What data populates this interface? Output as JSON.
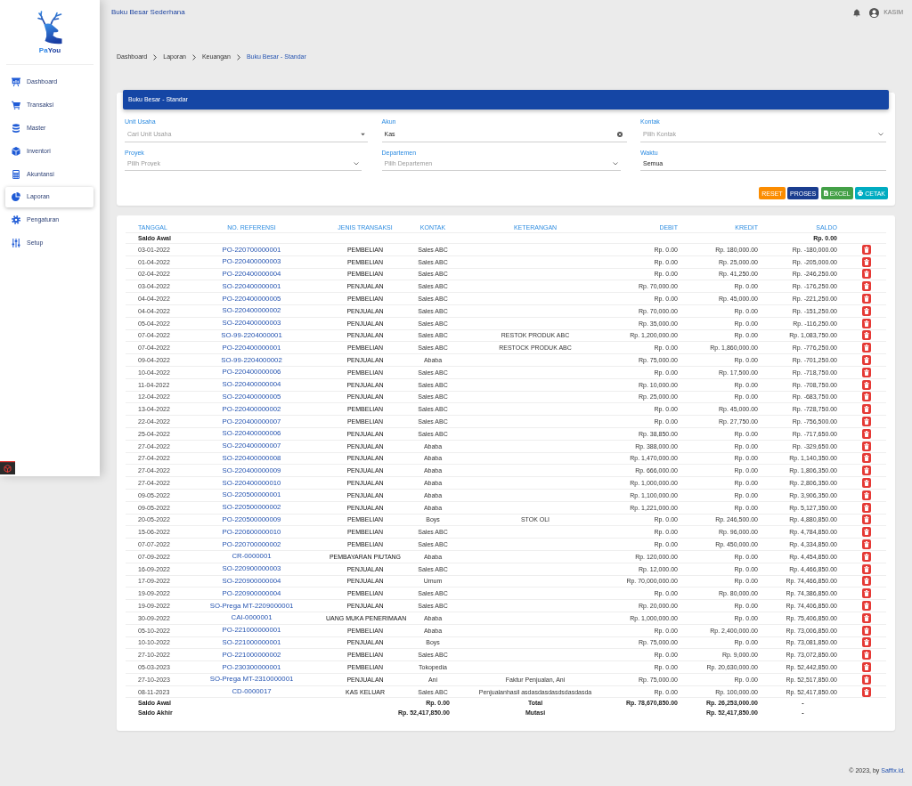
{
  "sidebar": {
    "brand": [
      "Pa",
      "You"
    ],
    "items": [
      {
        "label": "Dashboard",
        "selected": false
      },
      {
        "label": "Transaksi",
        "selected": false
      },
      {
        "label": "Master",
        "selected": false
      },
      {
        "label": "Inventori",
        "selected": false
      },
      {
        "label": "Akuntansi",
        "selected": false
      },
      {
        "label": "Laporan",
        "selected": true
      },
      {
        "label": "Pengaturan",
        "selected": false
      },
      {
        "label": "Setup",
        "selected": false
      }
    ]
  },
  "header": {
    "title": "Buku Besar Sederhana",
    "user": "KASIM"
  },
  "breadcrumb": [
    {
      "label": "Dashboard",
      "current": false
    },
    {
      "label": "Laporan",
      "current": false
    },
    {
      "label": "Keuangan",
      "current": false
    },
    {
      "label": "Buku Besar - Standar",
      "current": true
    }
  ],
  "filters": {
    "title": "Buku Besar - Standar",
    "fields": [
      {
        "label": "Unit Usaha",
        "kind": "combo",
        "placeholder": "Cari Unit Usaha"
      },
      {
        "label": "Akun",
        "kind": "clearable",
        "value": "Kas"
      },
      {
        "label": "Kontak",
        "kind": "select",
        "placeholder": "Pilih Kontak"
      },
      {
        "label": "Proyek",
        "kind": "select",
        "placeholder": "Pilih Proyek"
      },
      {
        "label": "Departemen",
        "kind": "select",
        "placeholder": "Pilih Departemen"
      },
      {
        "label": "Waktu",
        "kind": "text",
        "value": "Semua"
      }
    ],
    "buttons": [
      {
        "label": "RESET",
        "kind": "reset"
      },
      {
        "label": "PROSES",
        "kind": "process"
      },
      {
        "label": "EXCEL",
        "kind": "export"
      },
      {
        "label": "CETAK",
        "kind": "print"
      }
    ]
  },
  "ledger": {
    "columns": [
      "TANGGAL",
      "NO. REFERENSI",
      "JENIS TRANSAKSI",
      "KONTAK",
      "KETERANGAN",
      "DEBIT",
      "KREDIT",
      "SALDO"
    ],
    "opening": {
      "label": "Saldo Awal",
      "balance": "Rp. 0.00"
    },
    "rows": [
      {
        "date": "03-01-2022",
        "ref": "PO-220700000001",
        "type": "PEMBELIAN",
        "contact": "Sales ABC",
        "debit": "Rp. 0.00",
        "credit": "Rp. 180,000.00",
        "balance": "Rp. -180,000.00"
      },
      {
        "date": "01-04-2022",
        "ref": "PO-220400000003",
        "type": "PEMBELIAN",
        "contact": "Sales ABC",
        "debit": "Rp. 0.00",
        "credit": "Rp. 25,000.00",
        "balance": "Rp. -205,000.00"
      },
      {
        "date": "02-04-2022",
        "ref": "PO-220400000004",
        "type": "PEMBELIAN",
        "contact": "Sales ABC",
        "debit": "Rp. 0.00",
        "credit": "Rp. 41,250.00",
        "balance": "Rp. -246,250.00"
      },
      {
        "date": "03-04-2022",
        "ref": "SO-220400000001",
        "type": "PENJUALAN",
        "contact": "Sales ABC",
        "debit": "Rp. 70,000.00",
        "credit": "Rp. 0.00",
        "balance": "Rp. -176,250.00"
      },
      {
        "date": "04-04-2022",
        "ref": "PO-220400000005",
        "type": "PEMBELIAN",
        "contact": "Sales ABC",
        "debit": "Rp. 0.00",
        "credit": "Rp. 45,000.00",
        "balance": "Rp. -221,250.00"
      },
      {
        "date": "04-04-2022",
        "ref": "SO-220400000002",
        "type": "PENJUALAN",
        "contact": "Sales ABC",
        "debit": "Rp. 70,000.00",
        "credit": "Rp. 0.00",
        "balance": "Rp. -151,250.00"
      },
      {
        "date": "05-04-2022",
        "ref": "SO-220400000003",
        "type": "PENJUALAN",
        "contact": "Sales ABC",
        "debit": "Rp. 35,000.00",
        "credit": "Rp. 0.00",
        "balance": "Rp. -116,250.00"
      },
      {
        "date": "07-04-2022",
        "ref": "SO-99-2204000001",
        "type": "PENJUALAN",
        "contact": "Sales ABC",
        "note": "RESTOK PRODUK ABC",
        "debit": "Rp. 1,200,000.00",
        "credit": "Rp. 0.00",
        "balance": "Rp. 1,083,750.00"
      },
      {
        "date": "07-04-2022",
        "ref": "PO-220400000001",
        "type": "PEMBELIAN",
        "contact": "Sales ABC",
        "note": "RESTOCK PRODUK ABC",
        "debit": "Rp. 0.00",
        "credit": "Rp. 1,860,000.00",
        "balance": "Rp. -776,250.00"
      },
      {
        "date": "09-04-2022",
        "ref": "SO-99-2204000002",
        "type": "PENJUALAN",
        "contact": "Ababa",
        "debit": "Rp. 75,000.00",
        "credit": "Rp. 0.00",
        "balance": "Rp. -701,250.00"
      },
      {
        "date": "10-04-2022",
        "ref": "PO-220400000006",
        "type": "PEMBELIAN",
        "contact": "Sales ABC",
        "debit": "Rp. 0.00",
        "credit": "Rp. 17,500.00",
        "balance": "Rp. -718,750.00"
      },
      {
        "date": "11-04-2022",
        "ref": "SO-220400000004",
        "type": "PENJUALAN",
        "contact": "Sales ABC",
        "debit": "Rp. 10,000.00",
        "credit": "Rp. 0.00",
        "balance": "Rp. -708,750.00"
      },
      {
        "date": "12-04-2022",
        "ref": "SO-220400000005",
        "type": "PENJUALAN",
        "contact": "Sales ABC",
        "debit": "Rp. 25,000.00",
        "credit": "Rp. 0.00",
        "balance": "Rp. -683,750.00"
      },
      {
        "date": "13-04-2022",
        "ref": "PO-220400000002",
        "type": "PEMBELIAN",
        "contact": "Sales ABC",
        "debit": "Rp. 0.00",
        "credit": "Rp. 45,000.00",
        "balance": "Rp. -728,750.00"
      },
      {
        "date": "22-04-2022",
        "ref": "PO-220400000007",
        "type": "PEMBELIAN",
        "contact": "Sales ABC",
        "debit": "Rp. 0.00",
        "credit": "Rp. 27,750.00",
        "balance": "Rp. -756,500.00"
      },
      {
        "date": "25-04-2022",
        "ref": "SO-220400000006",
        "type": "PENJUALAN",
        "contact": "Sales ABC",
        "debit": "Rp. 38,850.00",
        "credit": "Rp. 0.00",
        "balance": "Rp. -717,650.00"
      },
      {
        "date": "27-04-2022",
        "ref": "SO-220400000007",
        "type": "PENJUALAN",
        "contact": "Ababa",
        "debit": "Rp. 388,000.00",
        "credit": "Rp. 0.00",
        "balance": "Rp. -329,650.00"
      },
      {
        "date": "27-04-2022",
        "ref": "SO-220400000008",
        "type": "PENJUALAN",
        "contact": "Ababa",
        "debit": "Rp. 1,470,000.00",
        "credit": "Rp. 0.00",
        "balance": "Rp. 1,140,350.00"
      },
      {
        "date": "27-04-2022",
        "ref": "SO-220400000009",
        "type": "PENJUALAN",
        "contact": "Ababa",
        "debit": "Rp. 666,000.00",
        "credit": "Rp. 0.00",
        "balance": "Rp. 1,806,350.00"
      },
      {
        "date": "27-04-2022",
        "ref": "SO-220400000010",
        "type": "PENJUALAN",
        "contact": "Ababa",
        "debit": "Rp. 1,000,000.00",
        "credit": "Rp. 0.00",
        "balance": "Rp. 2,806,350.00"
      },
      {
        "date": "09-05-2022",
        "ref": "SO-220500000001",
        "type": "PENJUALAN",
        "contact": "Ababa",
        "debit": "Rp. 1,100,000.00",
        "credit": "Rp. 0.00",
        "balance": "Rp. 3,906,350.00"
      },
      {
        "date": "09-05-2022",
        "ref": "SO-220500000002",
        "type": "PENJUALAN",
        "contact": "Ababa",
        "debit": "Rp. 1,221,000.00",
        "credit": "Rp. 0.00",
        "balance": "Rp. 5,127,350.00"
      },
      {
        "date": "20-05-2022",
        "ref": "PO-220500000009",
        "type": "PEMBELIAN",
        "contact": "Boys",
        "note": "STOK OLI",
        "debit": "Rp. 0.00",
        "credit": "Rp. 246,500.00",
        "balance": "Rp. 4,880,850.00"
      },
      {
        "date": "15-06-2022",
        "ref": "PO-220600000010",
        "type": "PEMBELIAN",
        "contact": "Sales ABC",
        "debit": "Rp. 0.00",
        "credit": "Rp. 96,000.00",
        "balance": "Rp. 4,784,850.00"
      },
      {
        "date": "07-07-2022",
        "ref": "PO-220700000002",
        "type": "PEMBELIAN",
        "contact": "Sales ABC",
        "debit": "Rp. 0.00",
        "credit": "Rp. 450,000.00",
        "balance": "Rp. 4,334,850.00"
      },
      {
        "date": "07-09-2022",
        "ref": "CR-0000001",
        "type": "PEMBAYARAN PIUTANG",
        "contact": "Ababa",
        "debit": "Rp. 120,000.00",
        "credit": "Rp. 0.00",
        "balance": "Rp. 4,454,850.00"
      },
      {
        "date": "16-09-2022",
        "ref": "SO-220900000003",
        "type": "PENJUALAN",
        "contact": "Sales ABC",
        "debit": "Rp. 12,000.00",
        "credit": "Rp. 0.00",
        "balance": "Rp. 4,466,850.00"
      },
      {
        "date": "17-09-2022",
        "ref": "SO-220900000004",
        "type": "PENJUALAN",
        "contact": "Umum",
        "debit": "Rp. 70,000,000.00",
        "credit": "Rp. 0.00",
        "balance": "Rp. 74,466,850.00"
      },
      {
        "date": "19-09-2022",
        "ref": "PO-220900000004",
        "type": "PEMBELIAN",
        "contact": "Sales ABC",
        "debit": "Rp. 0.00",
        "credit": "Rp. 80,000.00",
        "balance": "Rp. 74,386,850.00"
      },
      {
        "date": "19-09-2022",
        "ref": "SO-Prega MT-2209000001",
        "type": "PENJUALAN",
        "contact": "Sales ABC",
        "debit": "Rp. 20,000.00",
        "credit": "Rp. 0.00",
        "balance": "Rp. 74,406,850.00"
      },
      {
        "date": "30-09-2022",
        "ref": "CAI-0000001",
        "type": "UANG MUKA PENERIMAAN",
        "contact": "Ababa",
        "debit": "Rp. 1,000,000.00",
        "credit": "Rp. 0.00",
        "balance": "Rp. 75,406,850.00"
      },
      {
        "date": "05-10-2022",
        "ref": "PO-221000000001",
        "type": "PEMBELIAN",
        "contact": "Ababa",
        "debit": "Rp. 0.00",
        "credit": "Rp. 2,400,000.00",
        "balance": "Rp. 73,006,850.00"
      },
      {
        "date": "10-10-2022",
        "ref": "SO-221000000001",
        "type": "PENJUALAN",
        "contact": "Boys",
        "debit": "Rp. 75,000.00",
        "credit": "Rp. 0.00",
        "balance": "Rp. 73,081,850.00"
      },
      {
        "date": "27-10-2022",
        "ref": "PO-221000000002",
        "type": "PEMBELIAN",
        "contact": "Sales ABC",
        "debit": "Rp. 0.00",
        "credit": "Rp. 9,000.00",
        "balance": "Rp. 73,072,850.00"
      },
      {
        "date": "05-03-2023",
        "ref": "PO-230300000001",
        "type": "PEMBELIAN",
        "contact": "Tokopedia",
        "debit": "Rp. 0.00",
        "credit": "Rp. 20,630,000.00",
        "balance": "Rp. 52,442,850.00"
      },
      {
        "date": "27-10-2023",
        "ref": "SO-Prega MT-2310000001",
        "type": "PENJUALAN",
        "contact": "Ani",
        "note": "Faktur Penjualan, Ani",
        "debit": "Rp. 75,000.00",
        "credit": "Rp. 0.00",
        "balance": "Rp. 52,517,850.00"
      },
      {
        "date": "08-11-2023",
        "ref": "CD-0000017",
        "type": "KAS KELUAR",
        "contact": "Sales ABC",
        "note": "Penjualanhasil asdasdasdasdsdasdasda",
        "debit": "Rp. 0.00",
        "credit": "Rp. 100,000.00",
        "balance": "Rp. 52,417,850.00"
      }
    ],
    "summary": [
      {
        "label": "Saldo Awal",
        "value": "Rp. 0.00",
        "caption": "Total",
        "debit": "Rp. 78,670,850.00",
        "credit": "Rp. 26,253,000.00",
        "balance": "-"
      },
      {
        "label": "Saldo Akhir",
        "value": "Rp. 52,417,850.00",
        "caption": "Mutasi",
        "credit": "Rp. 52,417,850.00",
        "balance": "-"
      }
    ]
  },
  "footer": {
    "text": "© 2023, by",
    "link": "Saffix.id",
    "suffix": "."
  }
}
